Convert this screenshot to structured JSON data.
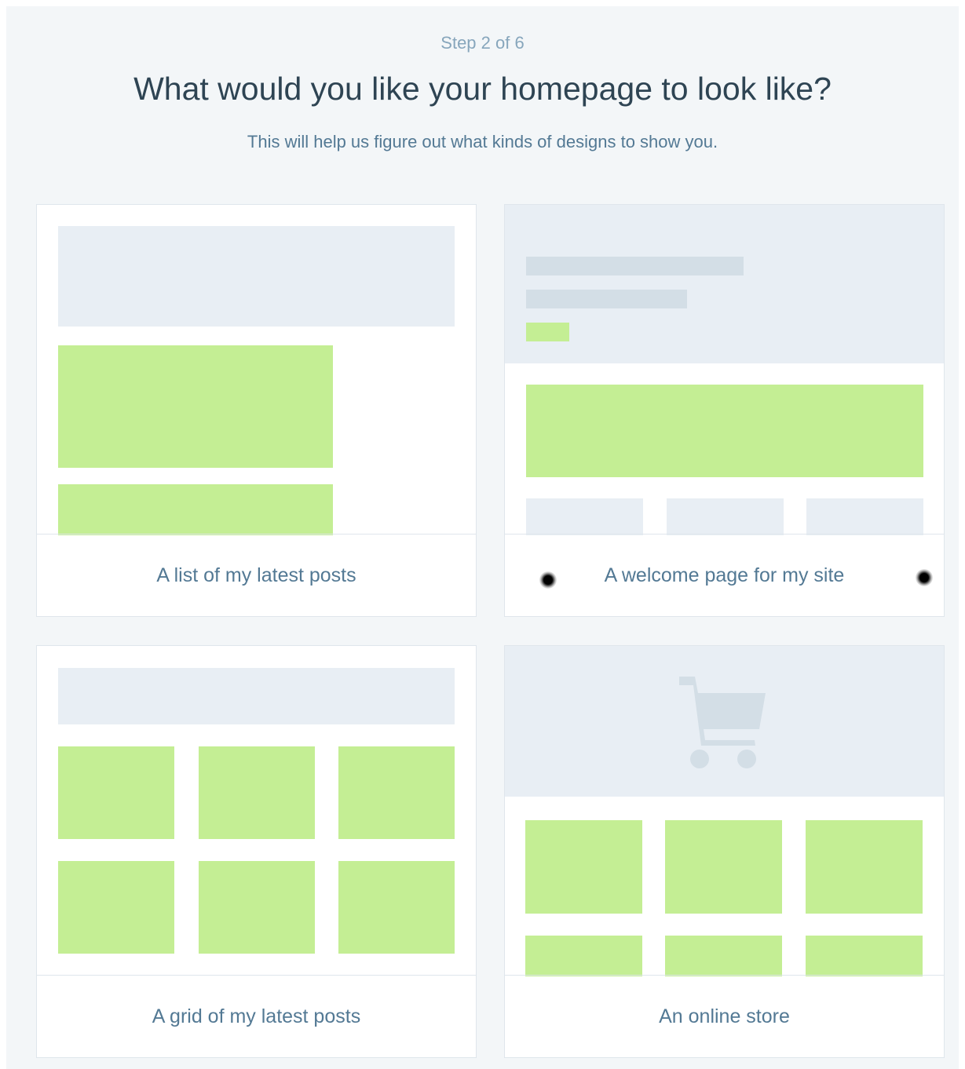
{
  "header": {
    "step": "Step 2 of 6",
    "title": "What would you like your homepage to look like?",
    "subtitle": "This will help us figure out what kinds of designs to show you."
  },
  "options": [
    {
      "label": "A list of my latest posts"
    },
    {
      "label": "A welcome page for my site"
    },
    {
      "label": "A grid of my latest posts"
    },
    {
      "label": "An online store",
      "icon": "shopping-cart-icon"
    }
  ],
  "colors": {
    "background": "#f3f6f8",
    "card": "#ffffff",
    "placeholder_green": "#c4ee94",
    "placeholder_light": "#e8eef4",
    "placeholder_medium": "#d3dee6",
    "title_text": "#2e4453",
    "caption_text": "#537994",
    "step_text": "#87a6bc"
  }
}
